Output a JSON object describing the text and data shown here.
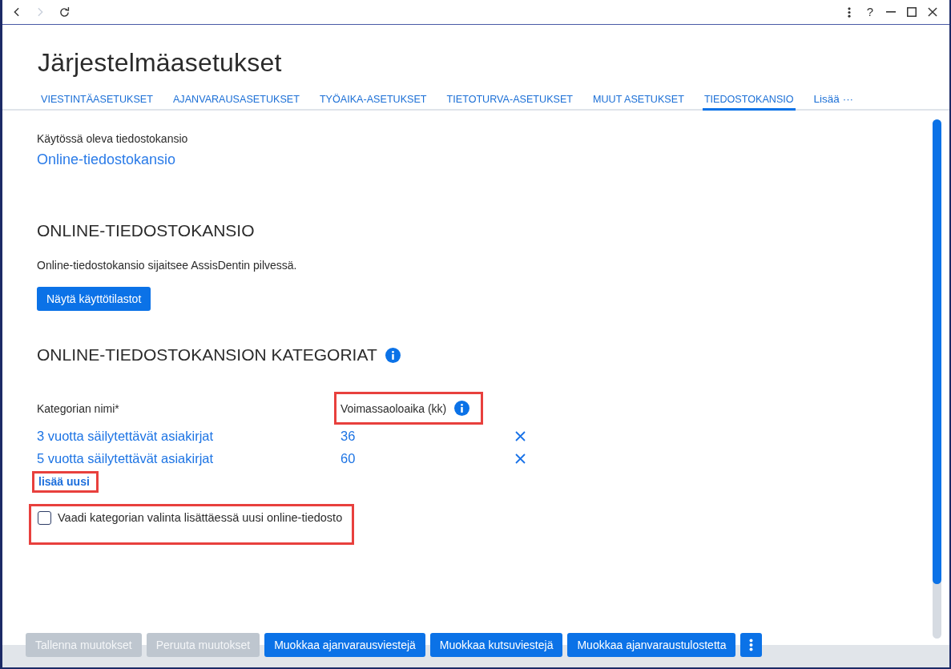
{
  "window": {
    "nav": [
      {
        "kind": "back",
        "disabled": false
      },
      {
        "kind": "forward",
        "disabled": true
      },
      {
        "kind": "reload",
        "disabled": false
      }
    ],
    "controls": [
      {
        "kind": "menu"
      },
      {
        "kind": "help",
        "label": "?"
      },
      {
        "kind": "minimize"
      },
      {
        "kind": "maximize"
      },
      {
        "kind": "close"
      }
    ]
  },
  "page": {
    "title": "Järjestelmäasetukset"
  },
  "tabs": [
    {
      "label": "VIESTINTÄASETUKSET",
      "selected": false
    },
    {
      "label": "AJANVARAUSASETUKSET",
      "selected": false
    },
    {
      "label": "TYÖAIKA-ASETUKSET",
      "selected": false
    },
    {
      "label": "TIETOTURVA-ASETUKSET",
      "selected": false
    },
    {
      "label": "MUUT ASETUKSET",
      "selected": false
    },
    {
      "label": "TIEDOSTOKANSIO",
      "selected": true
    }
  ],
  "tabs_more": {
    "label": "Lisää ···"
  },
  "current_folder": {
    "label": "Käytössä oleva tiedostokansio",
    "value": "Online-tiedostokansio"
  },
  "online_folder": {
    "heading": "ONLINE-TIEDOSTOKANSIO",
    "description": "Online-tiedostokansio sijaitsee AssisDentin pilvessä.",
    "button": "Näytä käyttötilastot"
  },
  "categories": {
    "heading": "ONLINE-TIEDOSTOKANSION KATEGORIAT",
    "columns": [
      {
        "label": "Kategorian nimi*",
        "info": false,
        "highlighted": false
      },
      {
        "label": "Voimassaoloaika (kk)",
        "info": true,
        "highlighted": true
      }
    ],
    "rows": [
      {
        "name": "3 vuotta säilytettävät asiakirjat",
        "months": "36"
      },
      {
        "name": "5 vuotta säilytettävät asiakirjat",
        "months": "60"
      }
    ],
    "add_link": {
      "label": "lisää uusi",
      "highlighted": true
    },
    "require_category": {
      "label": "Vaadi kategorian valinta lisättäessä uusi online-tiedosto",
      "checked": false,
      "highlighted": true
    }
  },
  "footer": {
    "buttons": [
      {
        "label": "Tallenna muutokset",
        "disabled": true
      },
      {
        "label": "Peruuta muutokset",
        "disabled": true
      },
      {
        "label": "Muokkaa ajanvarausviestejä",
        "disabled": false
      },
      {
        "label": "Muokkaa kutsuviestejä",
        "disabled": false
      },
      {
        "label": "Muokkaa ajanvaraustulostetta",
        "disabled": false
      }
    ]
  }
}
